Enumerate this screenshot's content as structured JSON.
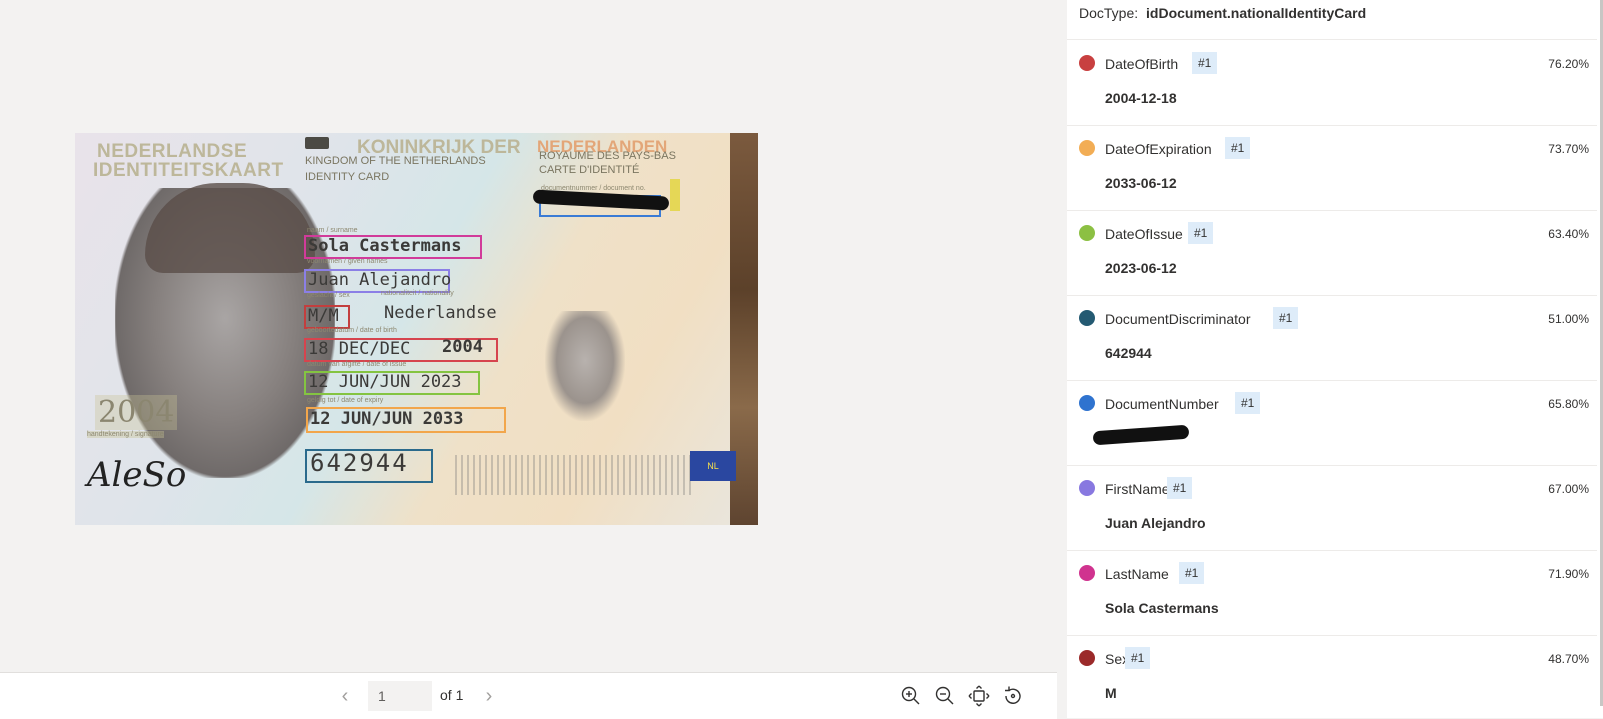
{
  "viewer": {
    "card": {
      "header_nl_1": "NEDERLANDSE",
      "header_nl_2": "IDENTITEITSKAART",
      "header_kingdom": "KONINKRIJK DER",
      "header_kingdom_en_1": "KINGDOM OF THE NETHERLANDS",
      "header_kingdom_en_2": "IDENTITY CARD",
      "header_nederlanden": "NEDERLANDEN",
      "header_fr_1": "ROYAUME DES PAYS-BAS",
      "header_fr_2": "CARTE D'IDENTITÉ",
      "label_docnumber": "documentnummer / document no.",
      "label_surname": "naam / surname",
      "surname": "Sola Castermans",
      "label_given": "voornamen / given names",
      "given": "Juan Alejandro",
      "label_sex": "geslacht / sex",
      "label_nationality": "nationaliteit / nationality",
      "sex": "M/M",
      "nationality": "Nederlandse",
      "label_dob": "geboortedatum / date of birth",
      "dob": "18 DEC/DEC",
      "dob_year": "2004",
      "label_issue": "datum van afgifte / date of issue",
      "issue": "12 JUN/JUN 2023",
      "label_expiry": "geldig tot / date of expiry",
      "expiry": "12 JUN/JUN 2033",
      "discriminator": "642944",
      "year_ghost": "2004",
      "label_signature": "handtekening / signature",
      "signature": "AleSo",
      "flag": "NL"
    },
    "pager": {
      "prev_icon": "chevron-left-icon",
      "page_value": "1",
      "of_label": "of 1",
      "next_icon": "chevron-right-icon",
      "tools": [
        "zoom-in-icon",
        "zoom-out-icon",
        "fit-to-page-icon",
        "rotate-icon"
      ]
    },
    "box_colors": {
      "surname": "#d13b9a",
      "given": "#8b7fe6",
      "sex": "#c33e3e",
      "dob": "#d6444e",
      "issue": "#84c441",
      "expiry": "#f2a64b",
      "discriminator": "#2a6a8c",
      "docnumber": "#3a7bd5"
    }
  },
  "panel": {
    "doctype_label": "DocType:",
    "doctype_value": "idDocument.nationalIdentityCard",
    "fields": [
      {
        "name": "DateOfBirth",
        "badge": "#1",
        "confidence": "76.20%",
        "value": "2004-12-18",
        "color": "#c84040"
      },
      {
        "name": "DateOfExpiration",
        "badge": "#1",
        "confidence": "73.70%",
        "value": "2033-06-12",
        "color": "#f2ad55"
      },
      {
        "name": "DateOfIssue",
        "badge": "#1",
        "confidence": "63.40%",
        "value": "2023-06-12",
        "color": "#8cc043"
      },
      {
        "name": "DocumentDiscriminator",
        "badge": "#1",
        "confidence": "51.00%",
        "value": "642944",
        "color": "#245a72"
      },
      {
        "name": "DocumentNumber",
        "badge": "#1",
        "confidence": "65.80%",
        "value": "",
        "color": "#2f73cf",
        "redacted": true
      },
      {
        "name": "FirstName",
        "badge": "#1",
        "confidence": "67.00%",
        "value": "Juan Alejandro",
        "color": "#8878e0"
      },
      {
        "name": "LastName",
        "badge": "#1",
        "confidence": "71.90%",
        "value": "Sola Castermans",
        "color": "#d0338f"
      },
      {
        "name": "Sex",
        "badge": "#1",
        "confidence": "48.70%",
        "value": "M",
        "color": "#9b2a2a"
      }
    ]
  }
}
